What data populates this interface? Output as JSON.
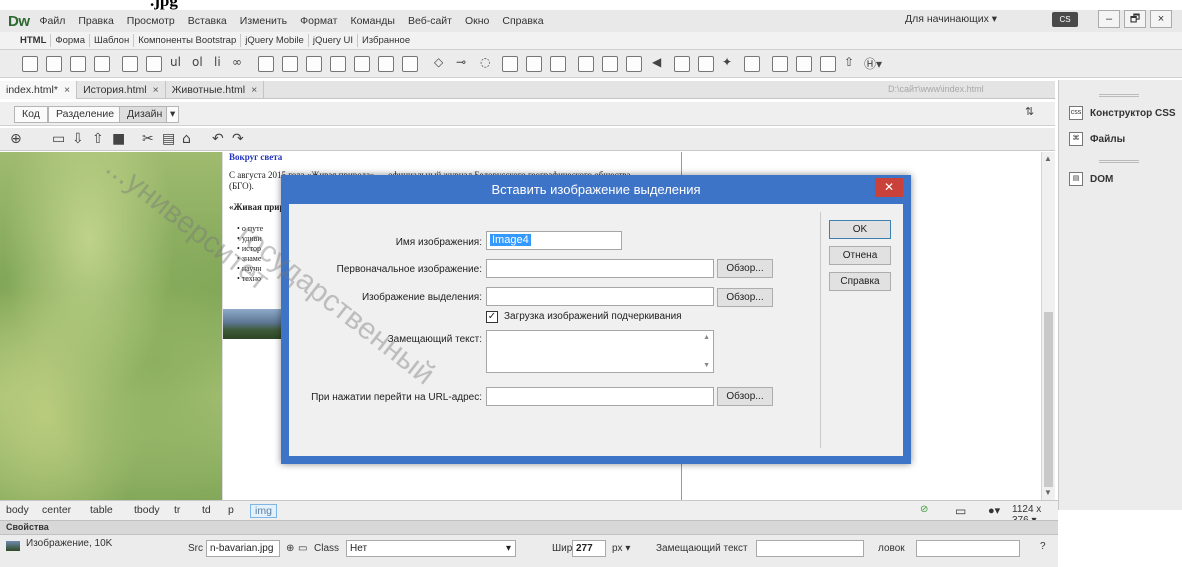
{
  "doc_strip": {
    "text": ".jpg"
  },
  "menubar": {
    "logo": "Dw",
    "items": [
      "Файл",
      "Правка",
      "Просмотр",
      "Вставка",
      "Изменить",
      "Формат",
      "Команды",
      "Веб-сайт",
      "Окно",
      "Справка"
    ],
    "workspace": "Для начинающих",
    "cs_label": "CS",
    "window_buttons": [
      "–",
      "🗗",
      "×"
    ]
  },
  "insert_tabs": [
    "HTML",
    "Форма",
    "Шаблон",
    "Компоненты Bootstrap",
    "jQuery Mobile",
    "jQuery UI",
    "Избранное"
  ],
  "doc_tabs": [
    {
      "label": "index.html*",
      "active": true
    },
    {
      "label": "История.html",
      "active": false
    },
    {
      "label": "Животные.html",
      "active": false
    }
  ],
  "doc_path": "D:\\сайт\\www\\index.html",
  "view_buttons": {
    "code": "Код",
    "split": "Разделение",
    "design": "Дизайн"
  },
  "right_panel": {
    "items": [
      "Конструктор CSS",
      "Файлы",
      "DOM"
    ],
    "icons": [
      "css-icon",
      "files-icon",
      "dom-icon"
    ]
  },
  "page": {
    "heading_link": "Вокруг света",
    "para": "С августа 2015 года «Живая природа» — официальный журнал Белорусского географического общества",
    "para2": "(БГО).",
    "sub": "«Живая прир",
    "bullets": [
      "о путе",
      "удиви",
      "истор",
      "знаме",
      "научн",
      "техно"
    ]
  },
  "tag_bar": {
    "tags": [
      "body",
      "center",
      "table",
      "tbody",
      "tr",
      "td",
      "p",
      "img"
    ],
    "size": "1124 x 376"
  },
  "properties": {
    "title": "Свойства",
    "image_label": "Изображение, 10K",
    "src_label": "Src",
    "src_value": "n-bavarian.jpg",
    "class_label": "Class",
    "class_value": "Нет",
    "width_label": "Шир",
    "width_value": "277",
    "width_unit": "px",
    "alt_label": "Замещающий текст",
    "title_label": "ловок"
  },
  "dialog": {
    "title": "Вставить изображение выделения",
    "name_label": "Имя изображения:",
    "name_value": "Image4",
    "original_label": "Первоначальное изображение:",
    "rollover_label": "Изображение выделения:",
    "preload_label": "Загрузка изображений подчеркивания",
    "alt_label": "Замещающий текст:",
    "url_label": "При нажатии перейти на URL-адрес:",
    "browse": "Обзор...",
    "ok": "OK",
    "cancel": "Отнена",
    "help": "Справка"
  },
  "watermark": [
    "...университет",
    "государственный"
  ]
}
